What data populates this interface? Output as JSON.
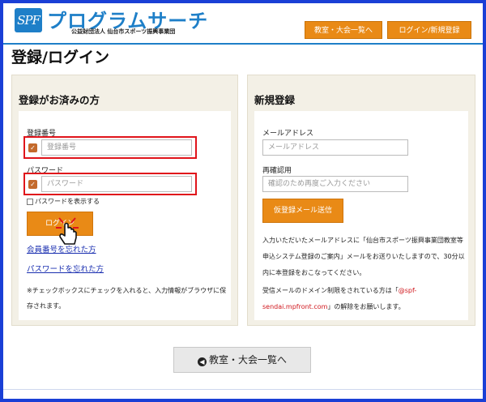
{
  "header": {
    "logo_text": "SPF",
    "title": "プログラムサーチ",
    "subtitle": "公益財団法人 仙台市スポーツ振興事業団",
    "nav_classes": "教室・大会一覧へ",
    "nav_login": "ログイン/新規登録",
    "accent_color": "#1e7fc8",
    "button_color": "#e98a16"
  },
  "page_title": "登録/ログイン",
  "login_panel": {
    "heading": "登録がお済みの方",
    "reg_label": "登録番号",
    "reg_placeholder": "登録番号",
    "pw_label": "パスワード",
    "pw_placeholder": "パスワード",
    "show_pw": "パスワードを表示する",
    "login_button": "ログイン",
    "forgot_id": "会員番号を忘れた方",
    "forgot_pw": "パスワードを忘れた方",
    "note": "※チェックボックスにチェックを入れると、入力情報がブラウザに保存されます。"
  },
  "register_panel": {
    "heading": "新規登録",
    "email_label": "メールアドレス",
    "email_placeholder": "メールアドレス",
    "confirm_label": "再確認用",
    "confirm_placeholder": "確認のため再度ご入力ください",
    "send_button": "仮登録メール送信",
    "info1": "入力いただいたメールアドレスに「仙台市スポーツ振興事業団教室等申込システム登録のご案内」メールをお送りいたしますので、30分以内に本登録をおこなってください。",
    "info2_pre": "受信メールのドメイン制限をされている方は「",
    "info2_domain": "@spf-sendai.mpfront.com",
    "info2_post": "」の解除をお願いします。"
  },
  "back_button": "教室・大会一覧へ"
}
